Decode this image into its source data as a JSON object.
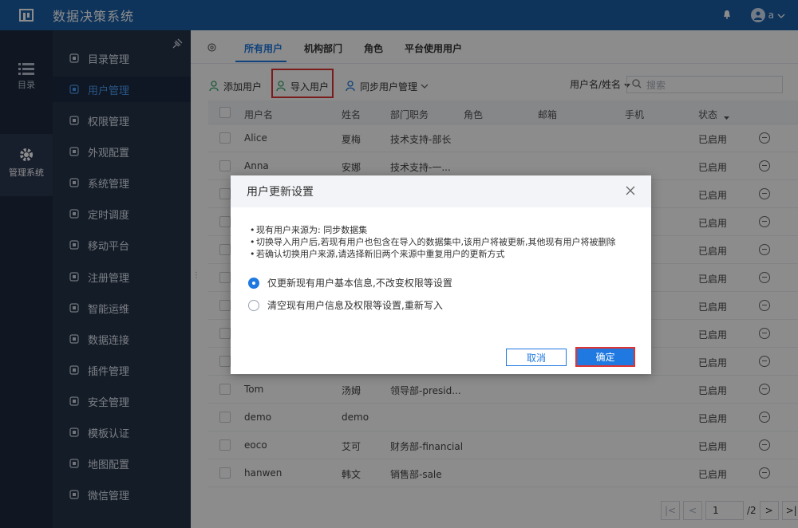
{
  "app": {
    "title": "数据决策系统",
    "user": "a"
  },
  "rail": [
    {
      "label": "目录",
      "icon": "list-icon"
    },
    {
      "label": "管理系统",
      "icon": "gear-icon"
    }
  ],
  "menu": [
    {
      "label": "目录管理",
      "icon": "catalog-icon"
    },
    {
      "label": "用户管理",
      "icon": "user-icon"
    },
    {
      "label": "权限管理",
      "icon": "lock-icon"
    },
    {
      "label": "外观配置",
      "icon": "brush-icon"
    },
    {
      "label": "系统管理",
      "icon": "gear-icon"
    },
    {
      "label": "定时调度",
      "icon": "clock-icon"
    },
    {
      "label": "移动平台",
      "icon": "mobile-icon"
    },
    {
      "label": "注册管理",
      "icon": "register-icon"
    },
    {
      "label": "智能运维",
      "icon": "ops-icon"
    },
    {
      "label": "数据连接",
      "icon": "link-icon"
    },
    {
      "label": "插件管理",
      "icon": "plugin-icon"
    },
    {
      "label": "安全管理",
      "icon": "shield-icon"
    },
    {
      "label": "模板认证",
      "icon": "template-icon"
    },
    {
      "label": "地图配置",
      "icon": "map-icon"
    },
    {
      "label": "微信管理",
      "icon": "wechat-icon"
    }
  ],
  "tabs": [
    "所有用户",
    "机构部门",
    "角色",
    "平台使用用户"
  ],
  "toolbar": {
    "add": "添加用户",
    "import": "导入用户",
    "sync": "同步用户管理"
  },
  "filter": {
    "label": "用户名/姓名",
    "placeholder": "搜索"
  },
  "table": {
    "headers": [
      "用户名",
      "姓名",
      "部门职务",
      "角色",
      "邮箱",
      "手机",
      "状态"
    ],
    "rows": [
      {
        "username": "Alice",
        "name": "夏梅",
        "dept": "技术支持-部长",
        "status": "已启用"
      },
      {
        "username": "Anna",
        "name": "安娜",
        "dept": "技术支持-一...",
        "status": "已启用"
      },
      {
        "username": "",
        "name": "",
        "dept": "",
        "status": "已启用"
      },
      {
        "username": "",
        "name": "",
        "dept": "",
        "status": "已启用"
      },
      {
        "username": "",
        "name": "",
        "dept": "",
        "status": "已启用"
      },
      {
        "username": "",
        "name": "",
        "dept": "",
        "status": "已启用"
      },
      {
        "username": "",
        "name": "",
        "dept": "",
        "status": "已启用"
      },
      {
        "username": "",
        "name": "",
        "dept": "",
        "status": "已启用"
      },
      {
        "username": "",
        "name": "",
        "dept": "",
        "status": "已启用"
      },
      {
        "username": "Tom",
        "name": "汤姆",
        "dept": "领导部-presid...",
        "status": "已启用"
      },
      {
        "username": "demo",
        "name": "demo",
        "dept": "",
        "status": "已启用"
      },
      {
        "username": "eoco",
        "name": "艾可",
        "dept": "财务部-financial",
        "status": "已启用"
      },
      {
        "username": "hanwen",
        "name": "韩文",
        "dept": "销售部-sale",
        "status": "已启用"
      }
    ]
  },
  "pager": {
    "page": "1",
    "total": "/2"
  },
  "dialog": {
    "title": "用户更新设置",
    "bullets": [
      "现有用户来源为: 同步数据集",
      "切换导入用户后,若现有用户也包含在导入的数据集中,该用户将被更新,其他现有用户将被删除",
      "若确认切换用户来源,请选择新旧两个来源中重复用户的更新方式"
    ],
    "options": [
      "仅更新现有用户基本信息,不改变权限等设置",
      "清空现有用户信息及权限等设置,重新写入"
    ],
    "selected": 0,
    "cancel": "取消",
    "ok": "确定"
  }
}
